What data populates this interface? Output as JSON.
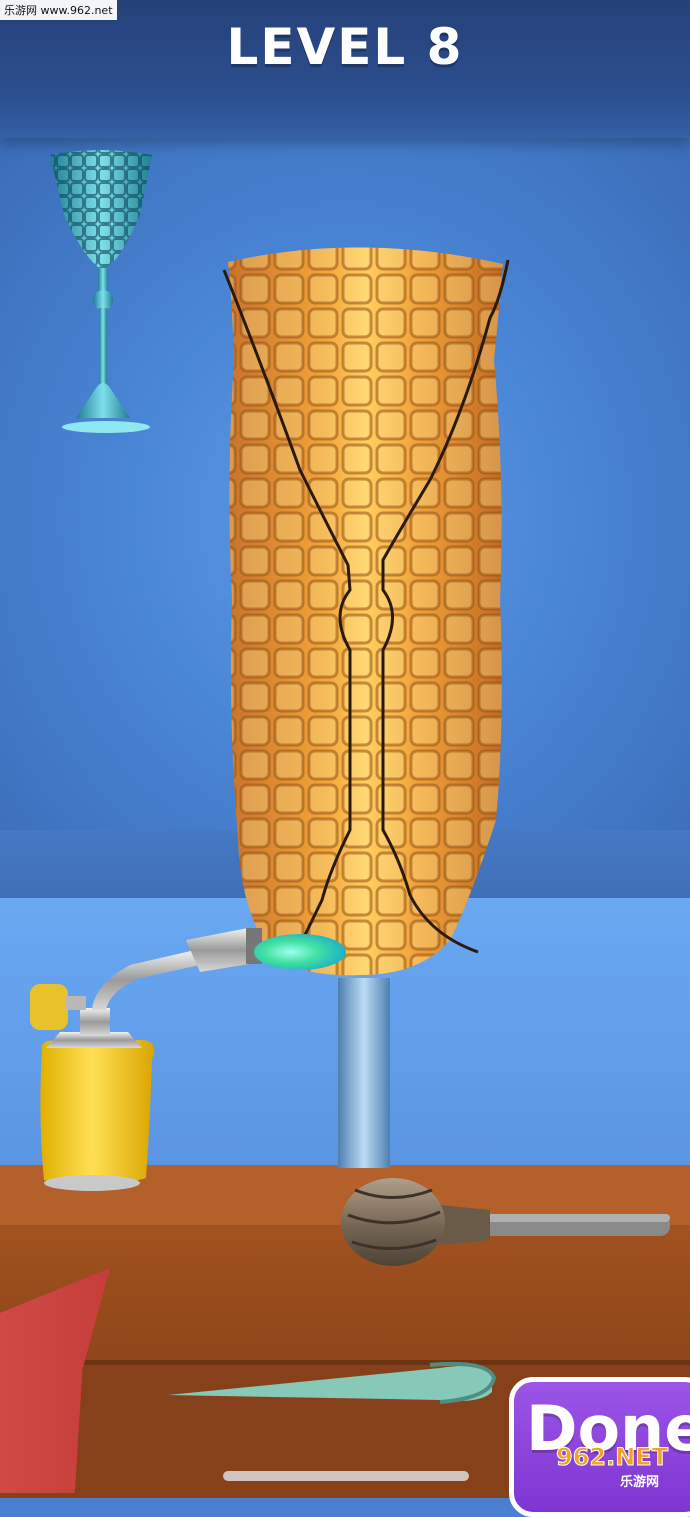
{
  "hud": {
    "level_title": "LEVEL 8"
  },
  "actions": {
    "done_label": "Done"
  },
  "watermarks": {
    "top_left": "乐游网 www.962.net",
    "bottom_right": "962.NET",
    "bottom_right_sub": "乐游网"
  },
  "colors": {
    "header": "#2c4f8e",
    "glass_blob": "#e8a030",
    "target_goblet": "#3fb0c0",
    "done_button": "#8a40dc",
    "flame": "#40e0a0",
    "table": "#b3602b"
  },
  "icons": {
    "target": "goblet-icon",
    "torch": "blowtorch-icon",
    "roller": "wrapped-roller-icon",
    "tweezers": "tweezers-icon"
  }
}
